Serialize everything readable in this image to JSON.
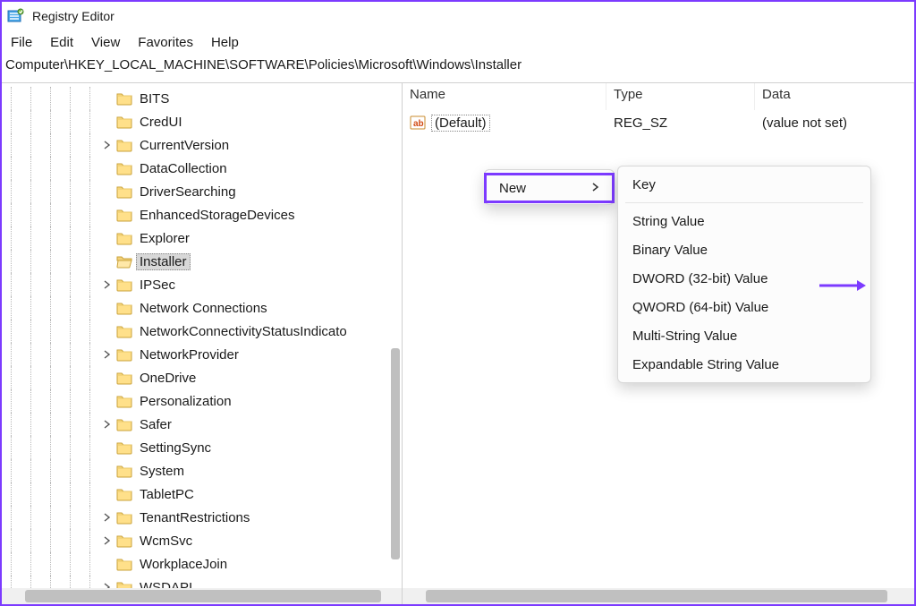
{
  "window": {
    "title": "Registry Editor"
  },
  "menu": {
    "items": [
      "File",
      "Edit",
      "View",
      "Favorites",
      "Help"
    ]
  },
  "path": "Computer\\HKEY_LOCAL_MACHINE\\SOFTWARE\\Policies\\Microsoft\\Windows\\Installer",
  "tree": {
    "items": [
      {
        "label": "BITS",
        "expandable": false
      },
      {
        "label": "CredUI",
        "expandable": false
      },
      {
        "label": "CurrentVersion",
        "expandable": true
      },
      {
        "label": "DataCollection",
        "expandable": false
      },
      {
        "label": "DriverSearching",
        "expandable": false
      },
      {
        "label": "EnhancedStorageDevices",
        "expandable": false
      },
      {
        "label": "Explorer",
        "expandable": false
      },
      {
        "label": "Installer",
        "expandable": false,
        "selected": true
      },
      {
        "label": "IPSec",
        "expandable": true
      },
      {
        "label": "Network Connections",
        "expandable": false
      },
      {
        "label": "NetworkConnectivityStatusIndicato",
        "expandable": false
      },
      {
        "label": "NetworkProvider",
        "expandable": true
      },
      {
        "label": "OneDrive",
        "expandable": false
      },
      {
        "label": "Personalization",
        "expandable": false
      },
      {
        "label": "Safer",
        "expandable": true
      },
      {
        "label": "SettingSync",
        "expandable": false
      },
      {
        "label": "System",
        "expandable": false
      },
      {
        "label": "TabletPC",
        "expandable": false
      },
      {
        "label": "TenantRestrictions",
        "expandable": true
      },
      {
        "label": "WcmSvc",
        "expandable": true
      },
      {
        "label": "WorkplaceJoin",
        "expandable": false
      },
      {
        "label": "WSDAPI",
        "expandable": true
      }
    ]
  },
  "list": {
    "columns": {
      "name": "Name",
      "type": "Type",
      "data": "Data"
    },
    "rows": [
      {
        "name": "(Default)",
        "type": "REG_SZ",
        "data": "(value not set)"
      }
    ]
  },
  "context_menu": {
    "primary": {
      "new_label": "New"
    },
    "submenu": {
      "items": [
        "Key",
        "String Value",
        "Binary Value",
        "DWORD (32-bit) Value",
        "QWORD (64-bit) Value",
        "Multi-String Value",
        "Expandable String Value"
      ]
    }
  },
  "annotations": {
    "highlight_color": "#7c3aff",
    "arrow_points_to": "DWORD (32-bit) Value"
  }
}
